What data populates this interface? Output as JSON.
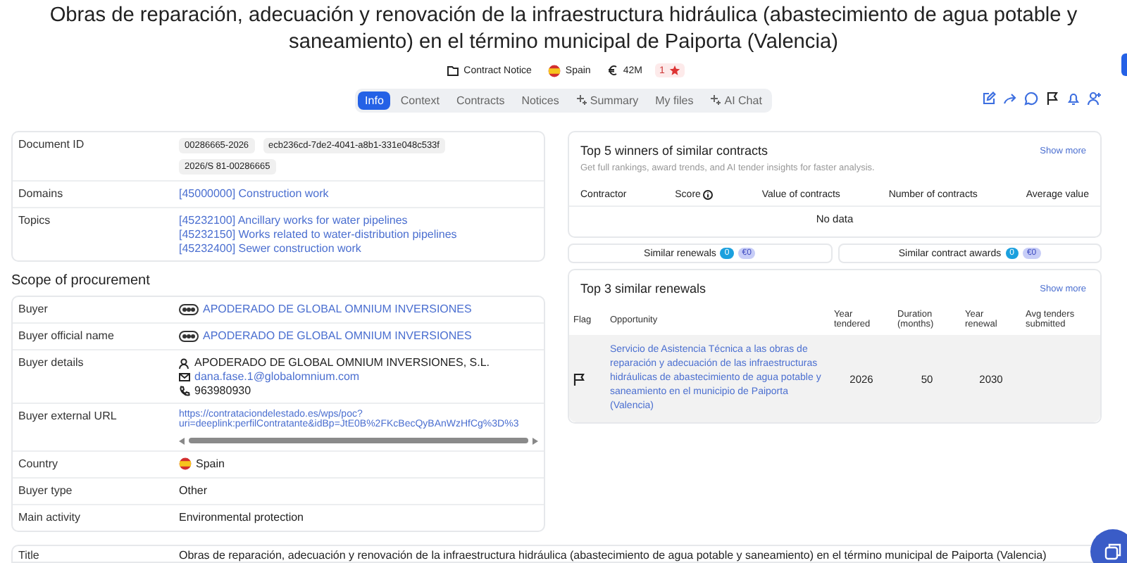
{
  "title": "Obras de reparación, adecuación y renovación de la infraestructura hidráulica (abastecimiento de agua potable y saneamiento) en el término municipal de Paiporta (Valencia)",
  "badges": [
    {
      "kind": "document",
      "text": "Contract Notice"
    },
    {
      "kind": "flag",
      "text": "Spain"
    },
    {
      "kind": "euro",
      "text": "42M"
    },
    {
      "kind": "star",
      "text": "1"
    }
  ],
  "tabs": [
    {
      "label": "Info",
      "selected": true,
      "kind": "plain"
    },
    {
      "label": "Context",
      "selected": false,
      "kind": "plain"
    },
    {
      "label": "Contracts",
      "selected": false,
      "kind": "plain"
    },
    {
      "label": "Notices",
      "selected": false,
      "kind": "plain"
    },
    {
      "label": "Summary",
      "selected": false,
      "kind": "sparkle"
    },
    {
      "label": "My files",
      "selected": false,
      "kind": "plain"
    },
    {
      "label": "AI Chat",
      "selected": false,
      "kind": "sparkle"
    }
  ],
  "details": [
    {
      "label": "Document ID",
      "kind": "chips",
      "values": [
        "00286665-2026",
        "ecb236cd-7de2-4041-a8b1-331e048c533f",
        "2026/S 81-00286665"
      ]
    },
    {
      "label": "Domains",
      "kind": "links",
      "values": [
        "[45000000] Construction work"
      ]
    },
    {
      "label": "Topics",
      "kind": "links",
      "values": [
        "[45232100] Ancillary works for water pipelines",
        "[45232150] Works related to water-distribution pipelines",
        "[45232400] Sewer construction work"
      ]
    }
  ],
  "scope": {
    "heading": "Scope of procurement",
    "rows": [
      {
        "label": "Buyer",
        "kind": "buyer",
        "values": [
          "APODERADO DE GLOBAL OMNIUM INVERSIONES"
        ]
      },
      {
        "label": "Buyer official name",
        "kind": "buyer",
        "values": [
          "APODERADO DE GLOBAL OMNIUM INVERSIONES"
        ]
      },
      {
        "label": "Buyer details",
        "kind": "contact",
        "values": [
          "APODERADO DE GLOBAL OMNIUM INVERSIONES, S.L.",
          "dana.fase.1@globalomnium.com",
          "963980930"
        ]
      },
      {
        "label": "Buyer external URL",
        "kind": "url",
        "values": [
          "https://contrataciondelestado.es/wps/poc?",
          "uri=deeplink:perfilContratante&idBp=JtE0B%2FKcBecQyBAnWzHfCg%3D%3"
        ]
      },
      {
        "label": "Country",
        "kind": "country",
        "values": [
          "Spain"
        ]
      },
      {
        "label": "Buyer type",
        "kind": "text",
        "values": [
          "Other"
        ]
      },
      {
        "label": "Main activity",
        "kind": "text",
        "values": [
          "Environmental protection"
        ]
      }
    ]
  },
  "bottom_row": {
    "label": "Title",
    "value": "Obras de reparación, adecuación y renovación de la infraestructura hidráulica (abastecimiento de agua potable y saneamiento) en el término municipal de Paiporta (Valencia)"
  },
  "winners": {
    "title": "Top 5 winners of similar contracts",
    "show_more": "Show more",
    "subtitle": "Get full rankings, award trends, and AI tender insights for faster analysis.",
    "columns": [
      {
        "label": "Contractor",
        "info": false
      },
      {
        "label": "Score",
        "info": true
      },
      {
        "label": "Value of contracts",
        "info": false
      },
      {
        "label": "Number of contracts",
        "info": false
      },
      {
        "label": "Average value",
        "info": false
      }
    ],
    "empty": "No data"
  },
  "similar": [
    {
      "label": "Similar renewals",
      "count": "0",
      "amount": "€0"
    },
    {
      "label": "Similar contract awards",
      "count": "0",
      "amount": "€0"
    }
  ],
  "renewals": {
    "title": "Top 3 similar renewals",
    "show_more": "Show more",
    "columns": [
      "Flag",
      "Opportunity",
      "Year tendered",
      "Duration (months)",
      "Year renewal",
      "Avg tenders submitted"
    ],
    "rows": [
      {
        "opportunity": "Servicio de Asistencia Técnica a las obras de reparación y adecuación de las infraestructuras hidráulicas de abastecimiento de agua potable y saneamiento en el municipio de Paiporta (Valencia)",
        "year_tendered": "2026",
        "duration": "50",
        "year_renewal": "2030"
      }
    ]
  }
}
